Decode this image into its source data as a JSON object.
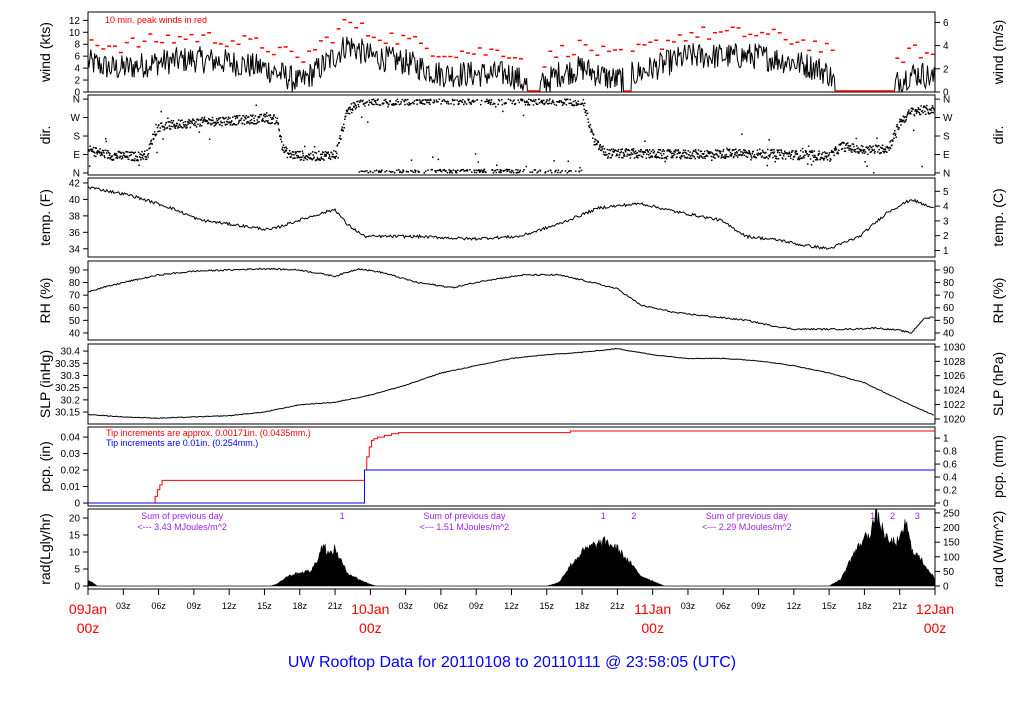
{
  "chart_data": {
    "type": "line",
    "title": "UW Rooftop Data for 20110108  to  20110111 @ 23:58:05  (UTC)",
    "x_unit": "hours since 09Jan 00z",
    "xlim": [
      0,
      72
    ],
    "x_hour_ticks": [
      "03z",
      "06z",
      "09z",
      "12z",
      "15z",
      "18z",
      "21z"
    ],
    "x_day_ticks": [
      {
        "hour": 0,
        "day": "09Jan",
        "time": "00z"
      },
      {
        "hour": 24,
        "day": "10Jan",
        "time": "00z"
      },
      {
        "hour": 48,
        "day": "11Jan",
        "time": "00z"
      },
      {
        "hour": 72,
        "day": "12Jan",
        "time": "00z"
      }
    ],
    "colors": {
      "line": "#000000",
      "peak": "#ff0000",
      "pcp_small": "#ff0000",
      "pcp_big": "#0000ff",
      "annot": "#a020f0",
      "day": "#ff0000",
      "title": "#0000ff"
    },
    "panels": {
      "wind": {
        "ylabel": "wind (kts)",
        "ylabel_right": "wind (m/s)",
        "ylim": [
          0,
          13.4
        ],
        "ylim_right": [
          0,
          6.9
        ],
        "ticks": [
          0,
          2,
          4,
          6,
          8,
          10,
          12
        ],
        "ticks_right": [
          0,
          2,
          4,
          6
        ],
        "annotation": "10 min. peak winds in red",
        "mean_hours": [
          0,
          2,
          3,
          6,
          9,
          12,
          15,
          17,
          18,
          20,
          21,
          22,
          23,
          24,
          27,
          30,
          33,
          36,
          37,
          38,
          40,
          42,
          44,
          45,
          48,
          51,
          54,
          57,
          60,
          62,
          63,
          64,
          68,
          69,
          70,
          71,
          72
        ],
        "mean_kts": [
          5,
          4,
          4,
          5,
          5.5,
          5,
          4,
          2.5,
          1.5,
          4.5,
          6,
          8,
          7,
          6,
          5,
          3,
          3,
          3,
          1.5,
          0.5,
          3,
          4,
          2.5,
          2,
          4,
          6,
          6,
          6,
          5,
          4,
          3,
          0,
          0,
          2,
          3,
          3,
          2
        ],
        "calm_intervals": [
          [
            37.3,
            38.4
          ],
          [
            63.5,
            68.6
          ],
          [
            45.5,
            46.2
          ]
        ]
      },
      "dir": {
        "ylabel": "dir.",
        "ylabel_right": "dir.",
        "ylim": [
          -10,
          380
        ],
        "ticks": [
          0,
          90,
          180,
          270,
          360
        ],
        "tick_labels": [
          "N",
          "E",
          "S",
          "W",
          "N"
        ],
        "hours": [
          0,
          2,
          4,
          5,
          5.5,
          6,
          8,
          10,
          12,
          15,
          16,
          16.5,
          17,
          19,
          21,
          22,
          23,
          24,
          30,
          36,
          42,
          43,
          44,
          50,
          56,
          62,
          63,
          64,
          66,
          68,
          69,
          70,
          72
        ],
        "degrees": [
          110,
          85,
          80,
          90,
          180,
          225,
          240,
          250,
          255,
          265,
          260,
          120,
          90,
          80,
          90,
          300,
          345,
          352,
          355,
          355,
          350,
          150,
          95,
          90,
          95,
          85,
          80,
          130,
          110,
          120,
          250,
          300,
          310
        ]
      },
      "temp": {
        "ylabel": "temp. (F)",
        "ylabel_right": "temp. (C)",
        "ylim": [
          33.0,
          42.6
        ],
        "ylim_right": [
          0.56,
          5.9
        ],
        "ticks": [
          34,
          36,
          38,
          40,
          42
        ],
        "ticks_right": [
          1,
          2,
          3,
          4,
          5
        ],
        "hours": [
          0,
          3.6,
          7,
          9.5,
          13,
          15.5,
          18,
          21,
          22,
          23.5,
          28,
          32.5,
          36.7,
          40,
          43.5,
          47,
          50,
          53.7,
          56,
          59,
          60.5,
          63,
          65.6,
          68,
          70,
          72
        ],
        "values": [
          41.5,
          40.5,
          39,
          37.5,
          36.8,
          36.3,
          37.5,
          38.8,
          37,
          35.5,
          35.5,
          35.2,
          35.5,
          37,
          39,
          39.5,
          38.5,
          37.5,
          35.5,
          35,
          34.5,
          34,
          35.5,
          38.5,
          40,
          38.8
        ]
      },
      "rh": {
        "ylabel": "RH (%)",
        "ylabel_right": "RH (%)",
        "ylim": [
          34.4,
          97.1
        ],
        "ylim_right": [
          34.4,
          97.1
        ],
        "ticks": [
          40,
          50,
          60,
          70,
          80,
          90
        ],
        "ticks_right": [
          40,
          50,
          60,
          70,
          80,
          90
        ],
        "hours": [
          0,
          3,
          6,
          9,
          12,
          15,
          18,
          21,
          23,
          25,
          28,
          31,
          34,
          37,
          40,
          42,
          45,
          47,
          50,
          53,
          56,
          58,
          60,
          63,
          65,
          67,
          69,
          70,
          71,
          72
        ],
        "values": [
          73,
          80,
          86,
          89,
          90,
          91,
          90,
          85,
          91,
          88,
          80,
          76,
          82,
          86,
          86,
          82,
          75,
          62,
          56,
          53,
          50,
          46,
          43,
          43,
          43,
          44,
          42,
          40,
          51,
          53
        ]
      },
      "slp": {
        "ylabel": "SLP (inHg)",
        "ylabel_right": "SLP (hPa)",
        "ylim": [
          30.101,
          30.429
        ],
        "ylim_right": [
          1019.3,
          1030.4
        ],
        "ticks": [
          30.15,
          30.2,
          30.25,
          30.3,
          30.35,
          30.4
        ],
        "ticks_right": [
          1020,
          1022,
          1024,
          1026,
          1028,
          1030
        ],
        "hours": [
          0,
          3,
          6,
          9,
          12,
          15,
          18,
          21,
          24,
          27,
          30,
          33,
          36,
          39,
          42,
          45,
          48,
          51,
          54,
          57,
          60,
          63,
          66,
          69,
          72
        ],
        "values": [
          30.14,
          30.13,
          30.125,
          30.13,
          30.135,
          30.15,
          30.18,
          30.19,
          30.22,
          30.26,
          30.31,
          30.34,
          30.37,
          30.385,
          30.395,
          30.41,
          30.385,
          30.37,
          30.37,
          30.36,
          30.34,
          30.31,
          30.27,
          30.2,
          30.135
        ]
      },
      "pcp": {
        "ylabel": "pcp. (in)",
        "ylabel_right": "pcp. (mm)",
        "ylim": [
          -0.0018,
          0.0461
        ],
        "ylim_right": [
          -0.046,
          1.171
        ],
        "ticks": [
          0,
          0.01,
          0.02,
          0.03,
          0.04
        ],
        "ticks_right": [
          0,
          0.2,
          0.4,
          0.6,
          0.8,
          1
        ],
        "legend_small": "Tip increments are approx. 0.00171in. (0.0435mm.)",
        "legend_big": "Tip increments are 0.01in. (0.254mm.)",
        "small_hours": [
          0,
          5.5,
          5.7,
          5.9,
          6.1,
          6.3,
          23.4,
          23.5,
          23.7,
          23.9,
          24.1,
          24.3,
          24.6,
          25.2,
          25.8,
          26.4,
          41,
          72
        ],
        "small_values": [
          0,
          0,
          0.004,
          0.008,
          0.011,
          0.0137,
          0.0137,
          0.02,
          0.028,
          0.034,
          0.038,
          0.039,
          0.04,
          0.041,
          0.042,
          0.0427,
          0.0437,
          0.0437
        ],
        "big_hours": [
          0,
          23.4,
          23.5,
          72
        ],
        "big_values": [
          0,
          0,
          0.02,
          0.02
        ]
      },
      "rad": {
        "ylabel": "rad(Lgly/hr)",
        "ylabel_right": "rad (W/m^2)",
        "ylim": [
          -0.88,
          22.65
        ],
        "ylim_right": [
          -10.2,
          263.4
        ],
        "ticks": [
          0,
          5,
          10,
          15,
          20
        ],
        "ticks_right": [
          0,
          50,
          100,
          150,
          200,
          250
        ],
        "hours": [
          0,
          0.3,
          0.8,
          15.5,
          16,
          17,
          18,
          19,
          19.5,
          20,
          20.5,
          21,
          22,
          23,
          24,
          24.5,
          39,
          40,
          41,
          42,
          43,
          44,
          45,
          46,
          47,
          48,
          49,
          63,
          64,
          65,
          66,
          66.5,
          67,
          68,
          69,
          69.5,
          70,
          71,
          72
        ],
        "values": [
          1.5,
          1.2,
          0,
          0,
          0.5,
          3,
          4,
          4.5,
          8,
          12.5,
          9,
          11,
          4,
          2,
          0.5,
          0,
          0,
          1,
          6,
          10,
          12,
          13,
          11,
          7,
          3,
          1.5,
          0,
          0,
          2,
          9,
          14,
          16,
          21,
          13,
          13,
          19,
          11,
          7,
          2
        ],
        "annotations": [
          {
            "hour": 8,
            "line1": "Sum of previous day",
            "line2": "<--- 3.43 MJoules/m^2"
          },
          {
            "hour": 32,
            "line1": "Sum of previous day",
            "line2": "<--- 1.51 MJoules/m^2"
          },
          {
            "hour": 56,
            "line1": "Sum of previous day",
            "line2": "<--- 2.29 MJoules/m^2"
          }
        ],
        "markers": [
          {
            "hour": 21.6,
            "label": "1"
          },
          {
            "hour": 43.8,
            "label": "1"
          },
          {
            "hour": 46.4,
            "label": "2"
          },
          {
            "hour": 66.7,
            "label": "1"
          },
          {
            "hour": 68.4,
            "label": "2"
          },
          {
            "hour": 70.5,
            "label": "3"
          }
        ]
      }
    }
  }
}
